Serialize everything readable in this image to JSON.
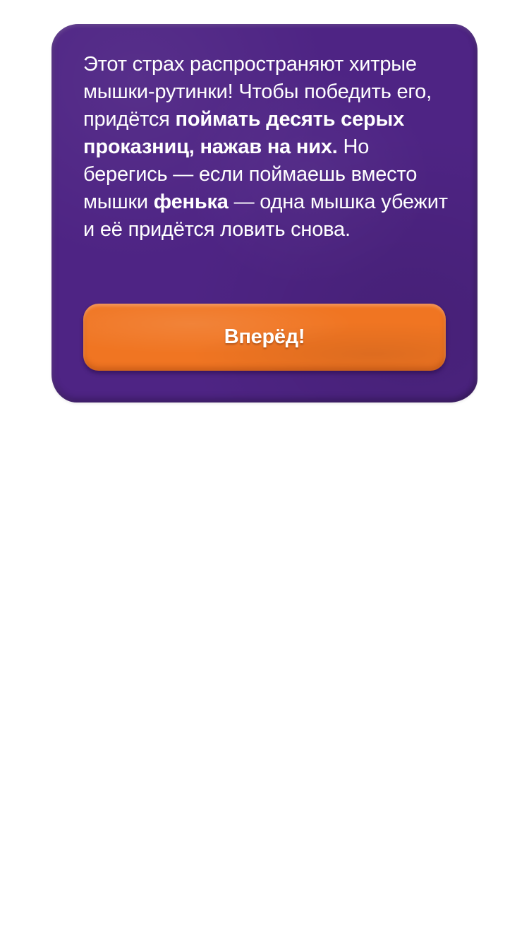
{
  "popup": {
    "text": {
      "part1": "Этот страх распространяют хитрые мышки-рутинки! Чтобы победить его, придётся ",
      "bold1": "поймать десять серых проказниц, нажав на них.",
      "part2": " Но берегись — если поймаешь вместо мышки ",
      "bold2": "фенька",
      "part3": " — одна мышка убежит и её придётся ловить снова."
    },
    "button_label": "Вперёд!"
  },
  "colors": {
    "card_background": "#4e2484",
    "button_background": "#f07522",
    "text": "#ffffff",
    "page_background": "#ffffff"
  }
}
